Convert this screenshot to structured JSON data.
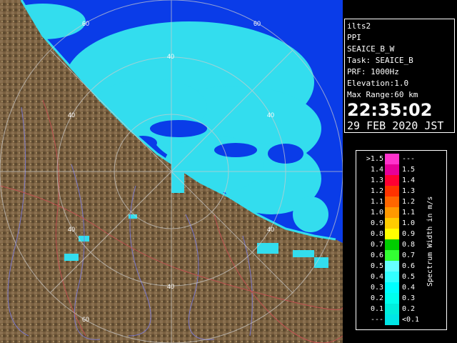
{
  "info": {
    "lines": [
      "ilts2",
      "PPI",
      "SEAICE_B_W",
      "Task: SEAICE_B",
      "PRF: 1000Hz",
      "Elevation:1.0",
      "Max Range:60 km"
    ],
    "time": "22:35:02",
    "date": "29 FEB 2020 JST"
  },
  "range_labels": [
    "60",
    "60",
    "40",
    "40",
    "40",
    "40",
    "40",
    "40",
    "60"
  ],
  "legend": {
    "unit": "Spectrum Width in m/s",
    "rows": [
      {
        "left": ">1.5",
        "right": "---",
        "color": "#ff33cc"
      },
      {
        "left": "1.4",
        "right": "1.5",
        "color": "#e60099"
      },
      {
        "left": "1.3",
        "right": "1.4",
        "color": "#ff0033"
      },
      {
        "left": "1.2",
        "right": "1.3",
        "color": "#ff3300"
      },
      {
        "left": "1.1",
        "right": "1.2",
        "color": "#ff6600"
      },
      {
        "left": "1.0",
        "right": "1.1",
        "color": "#ff9900"
      },
      {
        "left": "0.9",
        "right": "1.0",
        "color": "#ffcc00"
      },
      {
        "left": "0.8",
        "right": "0.9",
        "color": "#ffff00"
      },
      {
        "left": "0.7",
        "right": "0.8",
        "color": "#00cc00"
      },
      {
        "left": "0.6",
        "right": "0.7",
        "color": "#33ff33"
      },
      {
        "left": "0.5",
        "right": "0.6",
        "color": "#66ffff"
      },
      {
        "left": "0.4",
        "right": "0.5",
        "color": "#33ffff"
      },
      {
        "left": "0.3",
        "right": "0.4",
        "color": "#00ffff"
      },
      {
        "left": "0.2",
        "right": "0.3",
        "color": "#00ffee"
      },
      {
        "left": "0.1",
        "right": "0.2",
        "color": "#00eedd"
      },
      {
        "left": "---",
        "right": "<0.1",
        "color": "#00e6e6"
      }
    ]
  },
  "colors": {
    "sea": "#0a3ce8",
    "land": "#7a6040",
    "echo": "#33ddee"
  }
}
